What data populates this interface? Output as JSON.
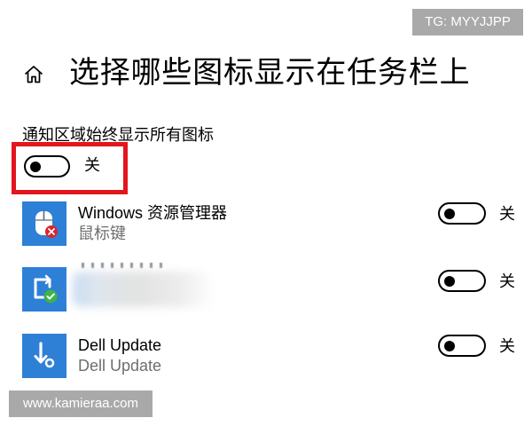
{
  "watermarks": {
    "top_right": "TG: MYYJJPP",
    "bottom_left": "www.kamieraa.com",
    "background": "#a9a9a9"
  },
  "header": {
    "home_icon": "home-icon",
    "title": "选择哪些图标显示在任务栏上"
  },
  "always_show": {
    "label": "通知区域始终显示所有图标",
    "checked": false,
    "state_label": "关",
    "highlight_color": "#e3161d"
  },
  "apps": [
    {
      "icon": "mouse-keys-icon",
      "name": "Windows 资源管理器",
      "subtitle": "鼠标键",
      "checked": false,
      "state_label": "关"
    },
    {
      "icon": "security-check-icon",
      "name": "",
      "subtitle": "",
      "redacted": true,
      "checked": false,
      "state_label": "关"
    },
    {
      "icon": "dell-update-icon",
      "name": "Dell Update",
      "subtitle": "Dell Update",
      "checked": false,
      "state_label": "关"
    }
  ],
  "colors": {
    "icon_tile": "#2e7fd6",
    "secondary_text": "#6e6e6e",
    "text": "#000000"
  }
}
